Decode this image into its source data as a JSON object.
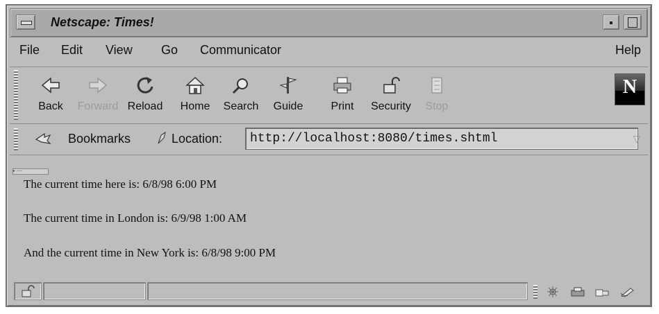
{
  "window": {
    "title": "Netscape: Times!"
  },
  "menu": {
    "items": [
      "File",
      "Edit",
      "View",
      "Go",
      "Communicator"
    ],
    "help": "Help"
  },
  "toolbar": {
    "buttons": [
      {
        "label": "Back",
        "icon": "back-arrow-icon",
        "enabled": true
      },
      {
        "label": "Forward",
        "icon": "forward-arrow-icon",
        "enabled": false
      },
      {
        "label": "Reload",
        "icon": "reload-icon",
        "enabled": true
      },
      {
        "label": "Home",
        "icon": "home-icon",
        "enabled": true
      },
      {
        "label": "Search",
        "icon": "search-icon",
        "enabled": true
      },
      {
        "label": "Guide",
        "icon": "guide-icon",
        "enabled": true
      },
      {
        "label": "Print",
        "icon": "print-icon",
        "enabled": true
      },
      {
        "label": "Security",
        "icon": "security-lock-icon",
        "enabled": true
      },
      {
        "label": "Stop",
        "icon": "stop-icon",
        "enabled": false
      }
    ],
    "logo_letter": "N"
  },
  "location": {
    "bookmarks_label": "Bookmarks",
    "location_label": "Location:",
    "url": "http://localhost:8080/times.shtml"
  },
  "content": {
    "lines": [
      "The current time here is: 6/8/98 6:00 PM",
      "The current time in London is: 6/9/98 1:00 AM",
      "And the current time in New York is: 6/8/98 9:00 PM"
    ]
  },
  "statusbar": {
    "icons": [
      "security-lock-icon",
      "navigator-icon",
      "mail-icon",
      "discussion-icon",
      "composer-icon"
    ]
  }
}
